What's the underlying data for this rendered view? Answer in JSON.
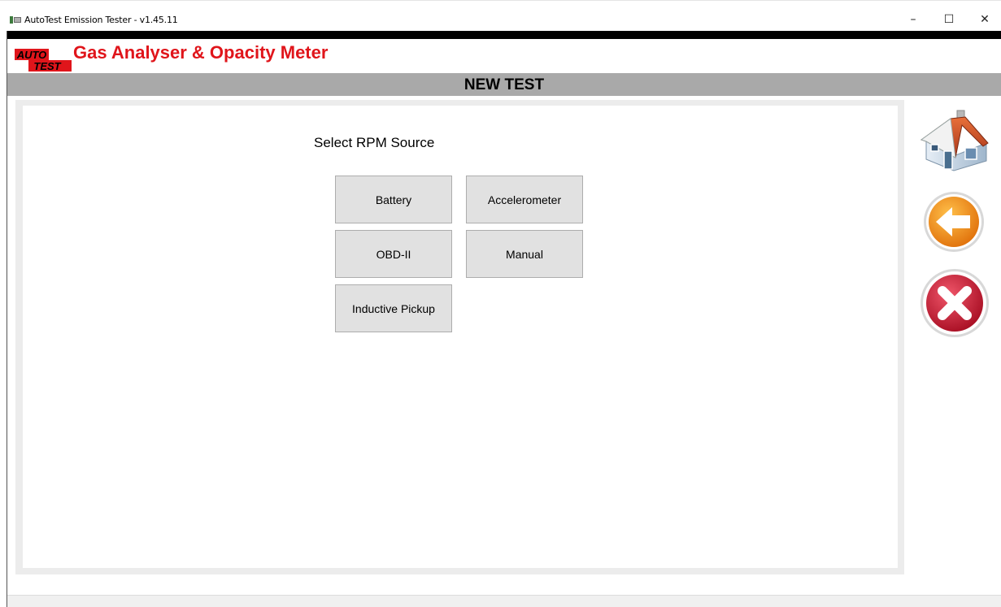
{
  "window": {
    "title": "AutoTest Emission Tester - v1.45.11",
    "controls": {
      "minimize": "–",
      "maximize": "☐",
      "close": "✕"
    }
  },
  "header": {
    "logo_top": "AUTO",
    "logo_bottom": "TEST",
    "app_title": "Gas Analyser & Opacity Meter"
  },
  "section": {
    "title": "NEW TEST"
  },
  "main": {
    "prompt": "Select RPM Source",
    "options": [
      {
        "id": "battery",
        "label": "Battery"
      },
      {
        "id": "accelerometer",
        "label": "Accelerometer"
      },
      {
        "id": "obd2",
        "label": "OBD-II"
      },
      {
        "id": "manual",
        "label": "Manual"
      },
      {
        "id": "inductive-pickup",
        "label": "Inductive Pickup"
      }
    ]
  },
  "sidebar": {
    "icons": [
      "home-icon",
      "back-arrow-icon",
      "cancel-icon"
    ]
  },
  "colors": {
    "brand_red": "#e0151b",
    "section_bar": "#a9a9a9",
    "button_face": "#e1e1e1",
    "back_orange": "#f7931e",
    "cancel_red": "#c8102e"
  }
}
